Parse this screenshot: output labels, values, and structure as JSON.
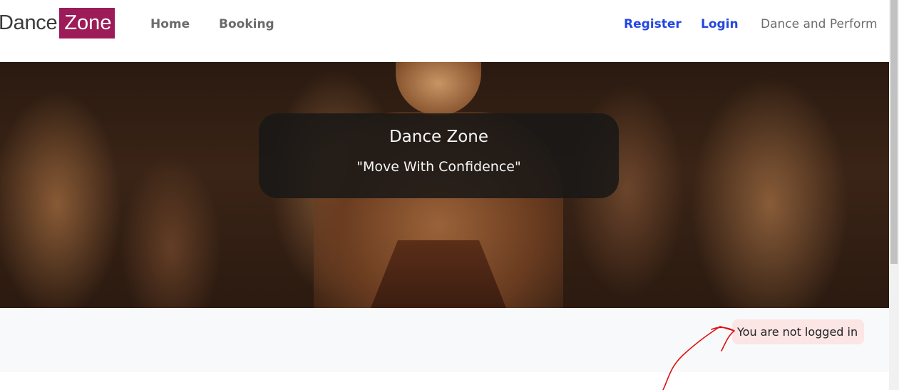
{
  "navbar": {
    "brand": {
      "part1": "Dance",
      "part2": "Zone"
    },
    "links": [
      {
        "label": "Home"
      },
      {
        "label": "Booking"
      }
    ],
    "auth": {
      "register": "Register",
      "login": "Login"
    },
    "tagline": "Dance and Perform"
  },
  "hero": {
    "title": "Dance Zone",
    "subtitle": "\"Move With Confidence\""
  },
  "status": {
    "message": "You are not logged in"
  },
  "colors": {
    "brand_accent": "#9c1b58",
    "link_blue": "#2446e0",
    "status_badge_bg": "#fbe5e5",
    "annotation_red": "#e01010"
  }
}
